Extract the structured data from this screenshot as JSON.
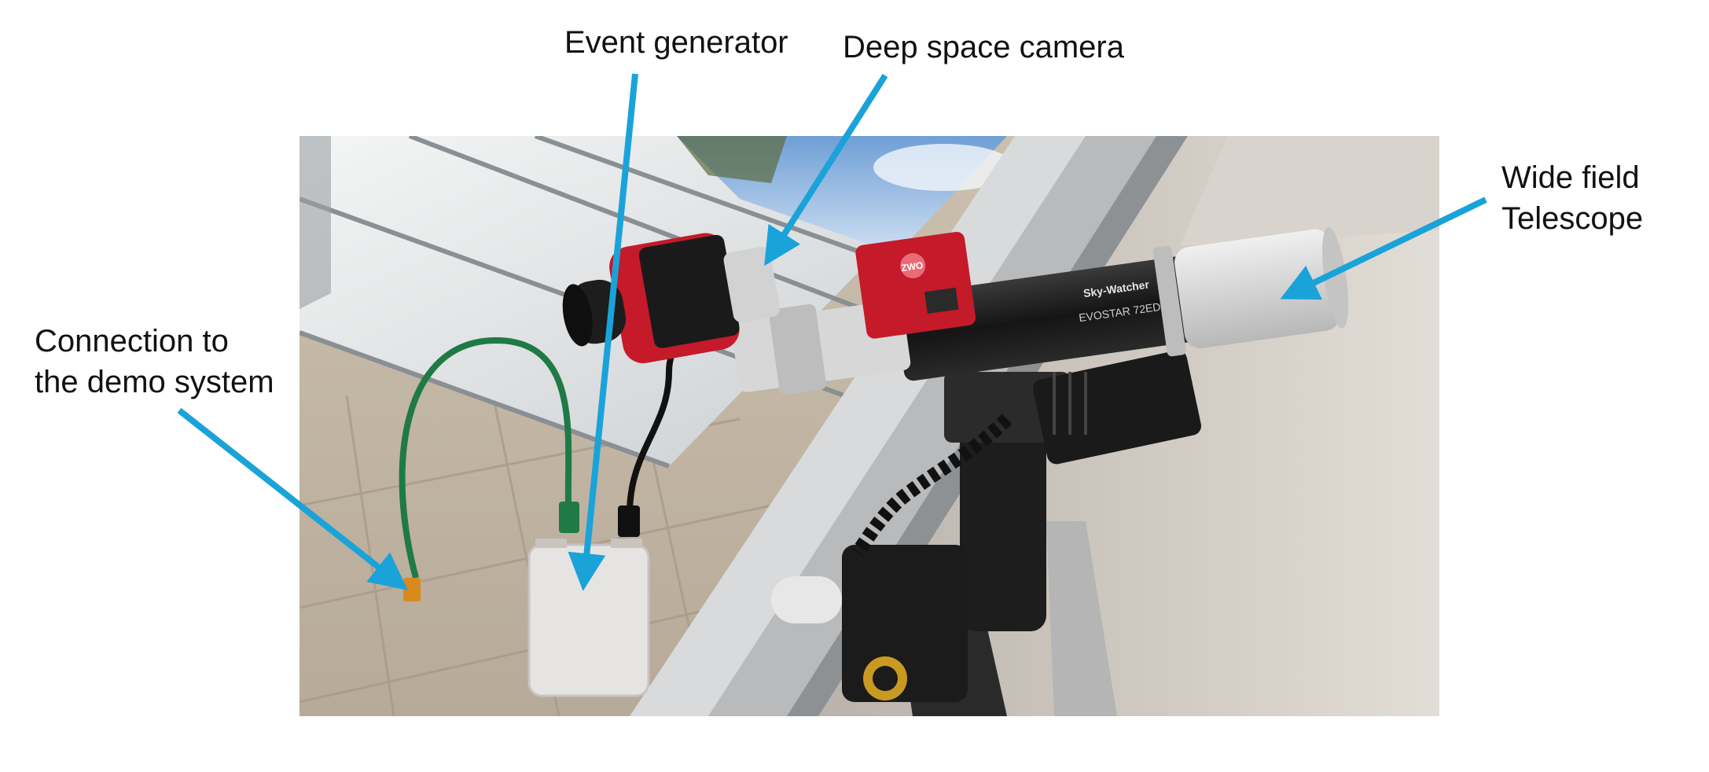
{
  "figure": {
    "annotations": {
      "event_generator": "Event generator",
      "deep_space_camera": "Deep space camera",
      "telescope_line1": "Wide field",
      "telescope_line2": "Telescope",
      "connection_line1": "Connection to",
      "connection_line2": "the demo system"
    },
    "colors": {
      "arrow": "#1aa3d9",
      "camera_red": "#c41a2a",
      "cable_green": "#1f7a45",
      "telescope_tube": "#1c1c1c",
      "dew_shield": "#dcdcdc",
      "box": "#e6e4e2"
    },
    "device_text": {
      "camera_brand": "ZWO",
      "telescope_brand": "Sky-Watcher",
      "telescope_model": "EVOSTAR 72ED"
    }
  }
}
